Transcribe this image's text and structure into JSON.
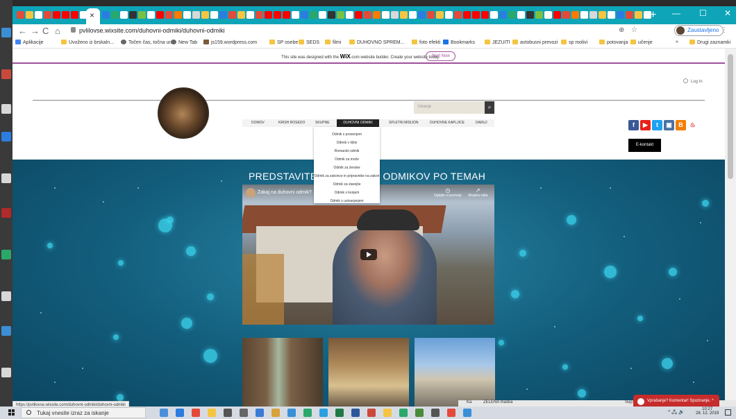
{
  "browser": {
    "new_tab": "+",
    "active_tab_close": "×",
    "window_controls": [
      "—",
      "☐",
      "✕"
    ],
    "url": "pvlilovse.wixsite.com/duhovni-odmiki/duhovni-odmiki",
    "profile_label": "Zaustavljeno",
    "nav_icons": [
      "←",
      "→",
      "C",
      "⌂"
    ],
    "right_icons": [
      "⊕",
      "☆",
      "⋮"
    ],
    "bookmarks": [
      {
        "label": "Aplikacije",
        "icon": "apps-icon"
      },
      {
        "label": "Uvoženo iz brskaln...",
        "icon": "folder-icon"
      },
      {
        "label": "Točen čas, točna ur...",
        "icon": "clock-icon"
      },
      {
        "label": "New Tab",
        "icon": "globe-icon"
      },
      {
        "label": "js159.wordpress.com",
        "icon": "site-icon"
      },
      {
        "label": "SP osebe",
        "icon": "folder-icon"
      },
      {
        "label": "SEDS",
        "icon": "folder-icon"
      },
      {
        "label": "filmi",
        "icon": "folder-icon"
      },
      {
        "label": "DUHOVNO SPREM...",
        "icon": "folder-icon"
      },
      {
        "label": "foto efekti",
        "icon": "folder-icon"
      },
      {
        "label": "Bookmarks",
        "icon": "star-icon"
      },
      {
        "label": "JEZUITI",
        "icon": "folder-icon"
      },
      {
        "label": "avtobusni prevozi",
        "icon": "folder-icon"
      },
      {
        "label": "sp molivi",
        "icon": "folder-icon"
      },
      {
        "label": "potovanja",
        "icon": "folder-icon"
      },
      {
        "label": "učenje",
        "icon": "folder-icon"
      },
      {
        "label": "»",
        "icon": "chevron-icon"
      },
      {
        "label": "Drugi zaznamki",
        "icon": "folder-icon"
      }
    ],
    "status_url": "https://pvlilovse.wixsite.com/duhovni-odmiki/duhovni-odmiki"
  },
  "wix_banner": {
    "text_before": "This site was designed with the ",
    "brand": "WiX",
    "text_after": ".com website builder. Create your website today.",
    "button": "Start Now"
  },
  "site": {
    "login": "Log In",
    "search_placeholder": "Iskanje",
    "search_icon": "⌕",
    "nav": [
      "DOMOV",
      "KRISH ROSEDO",
      "SKUPNE",
      "DUHOVNI ODMIKI",
      "SPLETNI MISIJON",
      "DUHOVNE KAPLJICE",
      "DARUJ"
    ],
    "dropdown": [
      "Odmik s prosenjem",
      "Odmik v tišini",
      "Romarski odmik",
      "Odmik za može",
      "Odmik za ženske",
      "Odmik za zakonce in pripravnike na zakon",
      "Odmik za starejše",
      "Odmik s konjem",
      "Odmik s ustvarjanjem"
    ],
    "social": [
      {
        "name": "facebook-icon",
        "glyph": "f",
        "color": "#3b5998"
      },
      {
        "name": "youtube-icon",
        "glyph": "▶",
        "color": "#e62117"
      },
      {
        "name": "twitter-icon",
        "glyph": "t",
        "color": "#1da1f2"
      },
      {
        "name": "image-icon",
        "glyph": "▣",
        "color": "#4a6fa5"
      },
      {
        "name": "blogger-icon",
        "glyph": "B",
        "color": "#f57d00"
      },
      {
        "name": "flame-icon",
        "glyph": "♨",
        "color": "#ffffff"
      }
    ],
    "contact_button": "E-kontakt",
    "hero_title": "PREDSTAVITEV DUHOVNIH ODMIKOV PO TEMAH",
    "video": {
      "title": "Zakaj na duhovni odmik?",
      "watch_later": "Oglejte si pozneje",
      "share": "Skupna raba",
      "watch_later_icon": "◷",
      "share_icon": "↗"
    },
    "chat": "Vprašanje? Komentar! Spoznanje. ^"
  },
  "bg_app": [
    "Ka",
    "ZELENA maška",
    "Sup: 4c"
  ],
  "taskbar": {
    "search": "Tukaj vnesite izraz za iskanje",
    "tray": "^ 🖧 🔊",
    "time": "10:27",
    "date": "28. 12. 2019"
  }
}
